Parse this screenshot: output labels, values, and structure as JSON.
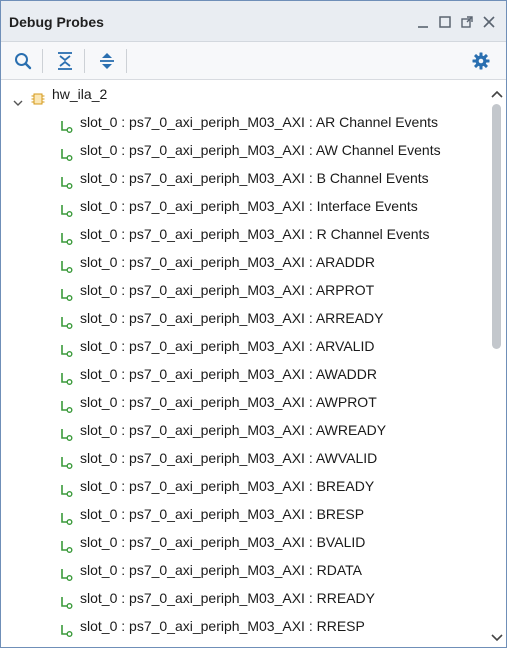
{
  "window": {
    "title": "Debug Probes",
    "controls": [
      "minimize-icon",
      "maximize-icon",
      "float-icon",
      "close-icon"
    ]
  },
  "toolbar": {
    "buttons": [
      "search-icon",
      "collapse-all-icon",
      "expand-all-icon",
      "gear-icon"
    ]
  },
  "tree": {
    "root": {
      "label": "hw_ila_2",
      "expanded": true
    },
    "probes": [
      "slot_0 : ps7_0_axi_periph_M03_AXI : AR Channel  Events",
      "slot_0 : ps7_0_axi_periph_M03_AXI : AW Channel  Events",
      "slot_0 : ps7_0_axi_periph_M03_AXI : B Channel  Events",
      "slot_0 : ps7_0_axi_periph_M03_AXI : Interface  Events",
      "slot_0 : ps7_0_axi_periph_M03_AXI : R Channel  Events",
      "slot_0 : ps7_0_axi_periph_M03_AXI : ARADDR",
      "slot_0 : ps7_0_axi_periph_M03_AXI : ARPROT",
      "slot_0 : ps7_0_axi_periph_M03_AXI : ARREADY",
      "slot_0 : ps7_0_axi_periph_M03_AXI : ARVALID",
      "slot_0 : ps7_0_axi_periph_M03_AXI : AWADDR",
      "slot_0 : ps7_0_axi_periph_M03_AXI : AWPROT",
      "slot_0 : ps7_0_axi_periph_M03_AXI : AWREADY",
      "slot_0 : ps7_0_axi_periph_M03_AXI : AWVALID",
      "slot_0 : ps7_0_axi_periph_M03_AXI : BREADY",
      "slot_0 : ps7_0_axi_periph_M03_AXI : BRESP",
      "slot_0 : ps7_0_axi_periph_M03_AXI : BVALID",
      "slot_0 : ps7_0_axi_periph_M03_AXI : RDATA",
      "slot_0 : ps7_0_axi_periph_M03_AXI : RREADY",
      "slot_0 : ps7_0_axi_periph_M03_AXI : RRESP"
    ]
  },
  "colors": {
    "accent": "#2a6fb0",
    "probe_icon": "#3a9a3a",
    "ila_icon": "#d49a1a"
  }
}
